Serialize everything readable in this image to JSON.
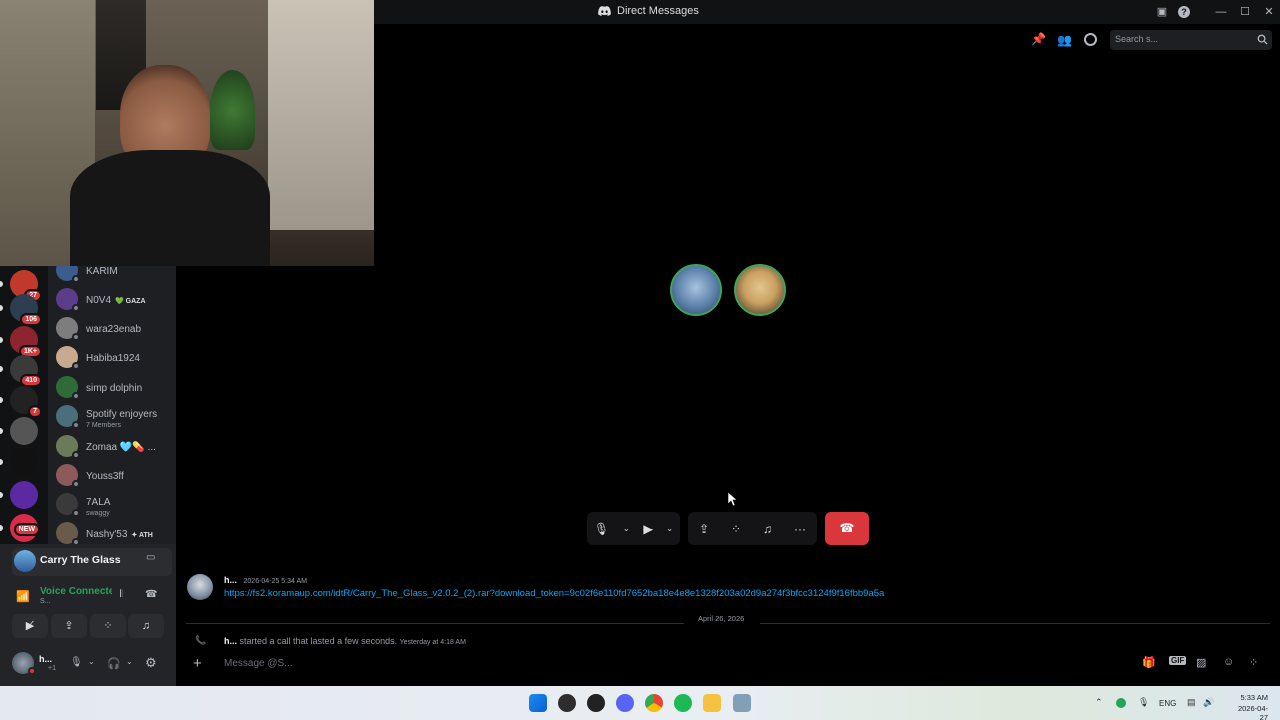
{
  "window": {
    "title": "Direct Messages"
  },
  "header": {
    "search_placeholder": "Search s..."
  },
  "servers": [
    {
      "badge": "27",
      "color": "#c0392b"
    },
    {
      "badge": "106",
      "color": "#2c3e50"
    },
    {
      "badge": "1K+",
      "color": "#8e2430"
    },
    {
      "badge": "410",
      "color": "#3a3a3a"
    },
    {
      "badge": "7",
      "color": "#222222"
    },
    {
      "badge": "",
      "color": "#555555"
    },
    {
      "badge": "",
      "color": "#111111"
    },
    {
      "badge": "",
      "color": "#5b2aa3"
    },
    {
      "badge": "NEW",
      "color": "#d92c4b"
    }
  ],
  "dms": [
    {
      "name": "KARIM",
      "sub": "",
      "tag": "",
      "color": "#3b5c8c"
    },
    {
      "name": "N0V4",
      "sub": "",
      "tag": "💚 GAZA",
      "color": "#5b3d8c"
    },
    {
      "name": "wara23enab",
      "sub": "",
      "tag": "",
      "color": "#7d7d7d"
    },
    {
      "name": "Habiba1924",
      "sub": "",
      "tag": "",
      "color": "#c9a98f"
    },
    {
      "name": "simp dolphin",
      "sub": "",
      "tag": "",
      "color": "#2e6b38"
    },
    {
      "name": "Spotify enjoyers",
      "sub": "7 Members",
      "tag": "",
      "color": "#4b6f7a"
    },
    {
      "name": "Zomaa 🩵💊 ...",
      "sub": "",
      "tag": "",
      "color": "#6b7b5a"
    },
    {
      "name": "Youss3ff",
      "sub": "",
      "tag": "",
      "color": "#8c5a5a"
    },
    {
      "name": "7ALA",
      "sub": "swaggy",
      "tag": "",
      "color": "#3a3a3a"
    },
    {
      "name": "Nashy'53",
      "sub": "",
      "tag": "✦ ATH",
      "color": "#6a5a4a"
    }
  ],
  "voice": {
    "channel": "Carry The Glass",
    "status": "Voice Connected",
    "status_sub": "S..."
  },
  "user": {
    "name": "h...",
    "sub": "+1"
  },
  "call": {
    "participants": [
      {
        "color": "#5a7fa8"
      },
      {
        "color": "#c9a060"
      }
    ]
  },
  "messages": {
    "author1": "h...",
    "time1": "2026-04-25 5:34 AM",
    "link": "https://fs2.koramaup.com/idtR/Carry_The_Glass_v2.0.2_(2).rar?download_token=9c02f6e110fd7652ba18e4e8e1328f203a02d9a274f3bfcc3124f9f16fbb9a5a",
    "divider": "April 26, 2026",
    "author2": "h...",
    "call_text": "started a call that lasted a few seconds.",
    "time2": "Yesterday at 4:18 AM",
    "input_placeholder": "Message @S..."
  },
  "taskbar": {
    "lang": "ENG",
    "time": "5:33 AM",
    "date": "2026-04-27"
  }
}
